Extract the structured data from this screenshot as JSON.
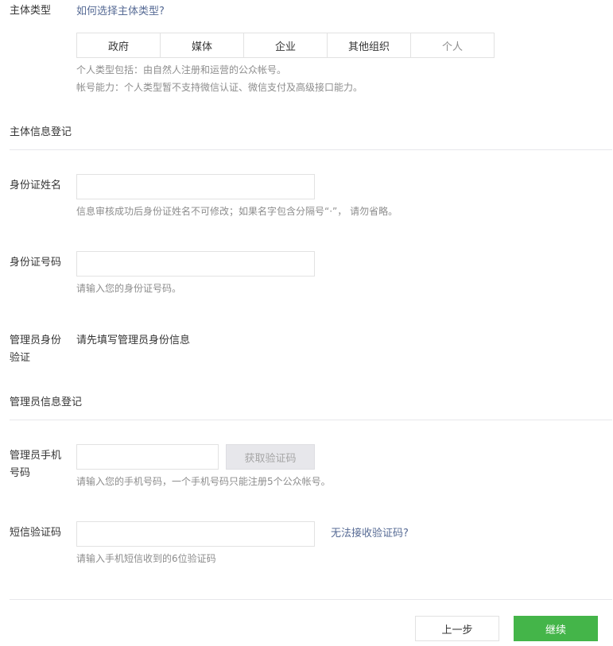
{
  "subject_type": {
    "label": "主体类型",
    "help_link": "如何选择主体类型?",
    "tabs": [
      "政府",
      "媒体",
      "企业",
      "其他组织",
      "个人"
    ],
    "selected": "个人",
    "tip_line1": "个人类型包括：由自然人注册和运营的公众帐号。",
    "tip_line2": "帐号能力：个人类型暂不支持微信认证、微信支付及高级接口能力。"
  },
  "subject_info": {
    "section_title": "主体信息登记",
    "id_name_label": "身份证姓名",
    "id_name_value": "",
    "id_name_tip": "信息审核成功后身份证姓名不可修改；如果名字包含分隔号“·”， 请勿省略。",
    "id_number_label": "身份证号码",
    "id_number_value": "",
    "id_number_tip": "请输入您的身份证号码。",
    "admin_verify_label_line1": "管理员身份",
    "admin_verify_label_line2": "验证",
    "admin_verify_text": "请先填写管理员身份信息"
  },
  "admin_info": {
    "section_title": "管理员信息登记",
    "phone_label_line1": "管理员手机",
    "phone_label_line2": "号码",
    "phone_value": "",
    "get_code_button": "获取验证码",
    "phone_tip": "请输入您的手机号码，一个手机号码只能注册5个公众帐号。",
    "sms_label": "短信验证码",
    "sms_value": "",
    "sms_help_link": "无法接收验证码?",
    "sms_tip": "请输入手机短信收到的6位验证码"
  },
  "footer": {
    "prev_button": "上一步",
    "continue_button": "继续"
  },
  "colors": {
    "link": "#576b95",
    "primary": "#44b549",
    "tip": "#8d8d8d"
  }
}
